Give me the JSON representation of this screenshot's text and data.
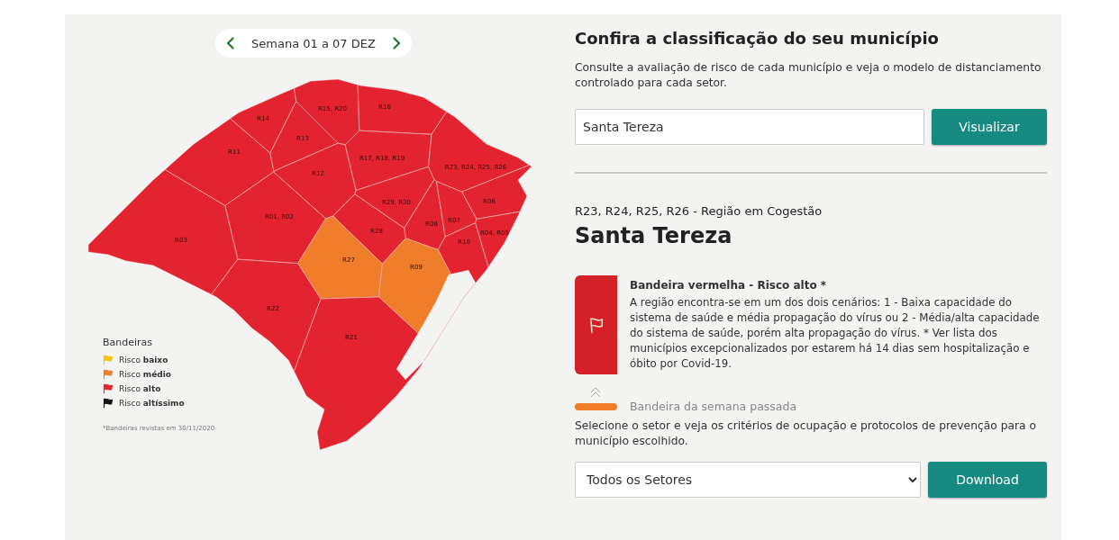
{
  "week_nav": {
    "label": "Semana 01 a 07 DEZ"
  },
  "map": {
    "regions": [
      {
        "label": "R14",
        "color": "#e3232f"
      },
      {
        "label": "R15, R20",
        "color": "#e3232f"
      },
      {
        "label": "R16",
        "color": "#e3232f"
      },
      {
        "label": "R11",
        "color": "#e3232f"
      },
      {
        "label": "R13",
        "color": "#e3232f"
      },
      {
        "label": "R12",
        "color": "#e3232f"
      },
      {
        "label": "R17, R18, R19",
        "color": "#e3232f"
      },
      {
        "label": "R23, R24, R25, R26",
        "color": "#e3232f"
      },
      {
        "label": "R01, R02",
        "color": "#e3232f"
      },
      {
        "label": "R03",
        "color": "#e3232f"
      },
      {
        "label": "R29, R30",
        "color": "#e3232f"
      },
      {
        "label": "R06",
        "color": "#e3232f"
      },
      {
        "label": "R08",
        "color": "#e3232f"
      },
      {
        "label": "R07",
        "color": "#e3232f"
      },
      {
        "label": "R28",
        "color": "#e3232f"
      },
      {
        "label": "R04, R05",
        "color": "#e3232f"
      },
      {
        "label": "R10",
        "color": "#e3232f"
      },
      {
        "label": "R27",
        "color": "#f07d2a"
      },
      {
        "label": "R09",
        "color": "#f07d2a"
      },
      {
        "label": "R22",
        "color": "#e3232f"
      },
      {
        "label": "R21",
        "color": "#e3232f"
      }
    ],
    "legend": {
      "title": "Bandeiras",
      "items": [
        {
          "label": "Risco **baixo**",
          "color": "#f5c518"
        },
        {
          "label": "Risco **médio**",
          "color": "#f07d2a"
        },
        {
          "label": "Risco **alto**",
          "color": "#e3232f"
        },
        {
          "label": "Risco **altíssimo**",
          "color": "#111111"
        }
      ],
      "note": "*Bandeiras revistas em 30/11/2020"
    }
  },
  "search": {
    "title": "Confira a classificação do seu município",
    "description": "Consulte a avaliação de risco de cada município e veja o modelo de distanciamento controlado para cada setor.",
    "value": "Santa Tereza",
    "button": "Visualizar"
  },
  "result": {
    "region": "R23, R24, R25, R26 - Região em Cogestão",
    "municipality": "Santa Tereza",
    "current_flag": {
      "title": "Bandeira vermelha - Risco alto *",
      "description": "A região encontra-se em um dos dois cenários: 1 - Baixa capacidade do sistema de saúde e média propagação do vírus ou 2 - Média/alta capacidade do sistema de saúde, porém alta propagação do vírus. * Ver lista dos municípios excepcionalizados por estarem há 14 dias sem hospitalização e óbito por Covid-19.",
      "color": "#d42027"
    },
    "previous_flag": {
      "label": "Bandeira da semana passada",
      "color": "#f07d2a"
    }
  },
  "sector": {
    "instruction": "Selecione o setor e veja os critérios de ocupação e protocolos de prevenção para o município escolhido.",
    "selected": "Todos os Setores",
    "button": "Download"
  }
}
